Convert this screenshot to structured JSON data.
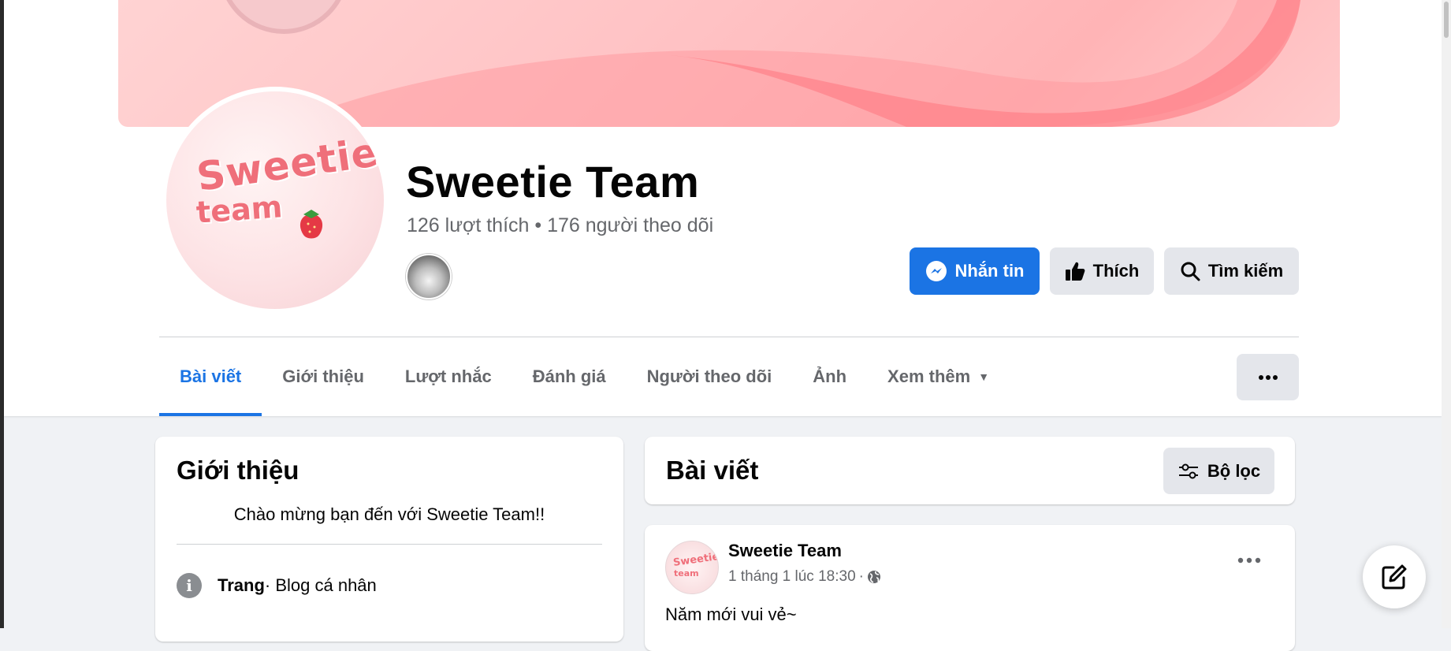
{
  "page": {
    "name": "Sweetie Team",
    "stats": "126 lượt thích • 176 người theo dõi",
    "avatar_text_line1": "Sweetie",
    "avatar_text_line2": "team"
  },
  "actions": {
    "message_label": "Nhắn tin",
    "like_label": "Thích",
    "search_label": "Tìm kiếm"
  },
  "tabs": [
    {
      "label": "Bài viết",
      "active": true
    },
    {
      "label": "Giới thiệu"
    },
    {
      "label": "Lượt nhắc"
    },
    {
      "label": "Đánh giá"
    },
    {
      "label": "Người theo dõi"
    },
    {
      "label": "Ảnh"
    },
    {
      "label": "Xem thêm"
    }
  ],
  "intro": {
    "title": "Giới thiệu",
    "bio": "Chào mừng bạn đến với Sweetie Team!!",
    "category_label": "Trang",
    "category_value": " · Blog cá nhân"
  },
  "posts_section": {
    "title": "Bài viết",
    "filter_label": "Bộ lọc"
  },
  "post": {
    "author": "Sweetie Team",
    "timestamp": "1 tháng 1 lúc 18:30",
    "text": "Năm mới vui vẻ~"
  },
  "colors": {
    "accent": "#1b74e4",
    "button_gray": "#e4e6eb",
    "background": "#f0f2f5",
    "secondary_text": "#65676b"
  }
}
